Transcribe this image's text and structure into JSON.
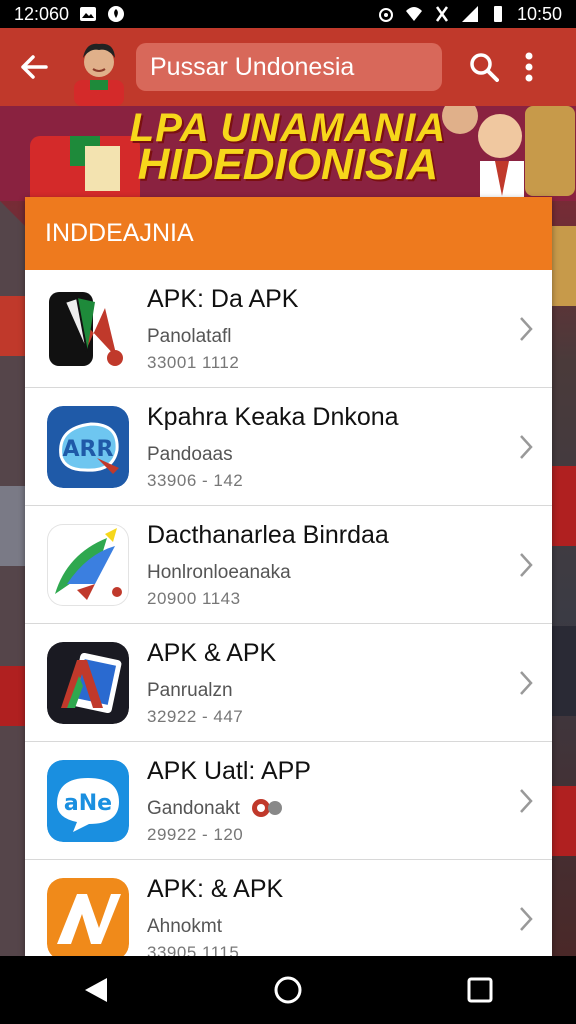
{
  "status_bar": {
    "time_left": "12:060",
    "time_right": "10:50"
  },
  "app_bar": {
    "search_value": "Pussar Undonesia"
  },
  "banner": {
    "line1": "LPA UNAMANIA",
    "line2": "HIDEDIONISIA"
  },
  "section": {
    "header": "INDDEAJNIA"
  },
  "apps": [
    {
      "title": "APK: Da APK",
      "subtitle": "Panolatafl",
      "meta": "33001 1112",
      "icon": "red-flag-app-icon",
      "color": "#111111"
    },
    {
      "title": "Kpahra Keaka Dnkona",
      "subtitle": "Pandoaas",
      "meta": "33906 - 142",
      "icon": "blue-logo-app-icon",
      "color": "#1f5aa8"
    },
    {
      "title": "Dacthanarlea Binrdaa",
      "subtitle": "Honlronloeanaka",
      "meta": "20900 1143",
      "icon": "colorful-bird-app-icon",
      "color": "#ffffff"
    },
    {
      "title": "APK & APK",
      "subtitle": "Panrualzn",
      "meta": "32922 - 447",
      "icon": "dark-tablet-app-icon",
      "color": "#1a1a22"
    },
    {
      "title": "APK Uatl: APP",
      "subtitle": "Gandonakt",
      "meta": "29922 - 120",
      "icon": "blue-speech-app-icon",
      "color": "#1a8fe0"
    },
    {
      "title": "APK: & APK",
      "subtitle": "Ahnokmt",
      "meta": "33905 1115",
      "icon": "orange-av-app-icon",
      "color": "#f08a1a"
    }
  ],
  "colors": {
    "app_bar": "#c0392b",
    "section_header": "#ee7a1e",
    "banner_text": "#f6d71b"
  }
}
